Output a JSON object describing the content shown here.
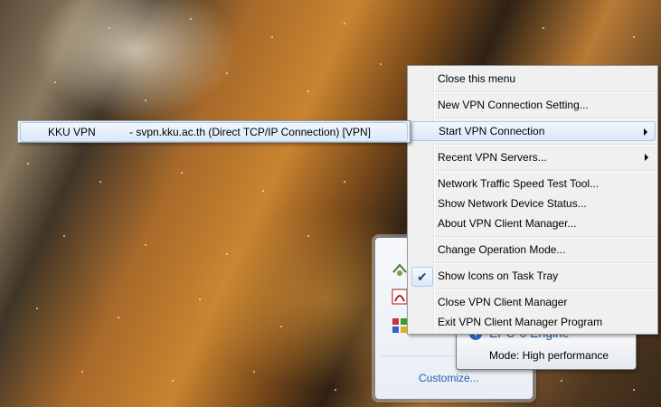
{
  "tray": {
    "customize_label": "Customize..."
  },
  "tooltip": {
    "title": "EPU-6 Engine",
    "mode": "Mode: High performance"
  },
  "context_menu": {
    "items": [
      {
        "label": "Close this menu"
      },
      {
        "label": "New VPN Connection Setting..."
      },
      {
        "label": "Start VPN Connection"
      },
      {
        "label": "Recent VPN Servers..."
      },
      {
        "label": "Network Traffic Speed Test Tool..."
      },
      {
        "label": "Show Network Device Status..."
      },
      {
        "label": "About VPN Client Manager..."
      },
      {
        "label": "Change Operation Mode..."
      },
      {
        "label": "Show Icons on Task Tray",
        "checked": true
      },
      {
        "label": "Close VPN Client Manager"
      },
      {
        "label": "Exit VPN Client Manager Program"
      }
    ]
  },
  "submenu": {
    "items": [
      {
        "name": "KKU VPN",
        "detail": "- svpn.kku.ac.th (Direct TCP/IP Connection) [VPN]"
      }
    ]
  },
  "colors": {
    "menu_bg": "#f0f0f0",
    "highlight": "#dbe9fa",
    "link": "#1f5fb0"
  }
}
